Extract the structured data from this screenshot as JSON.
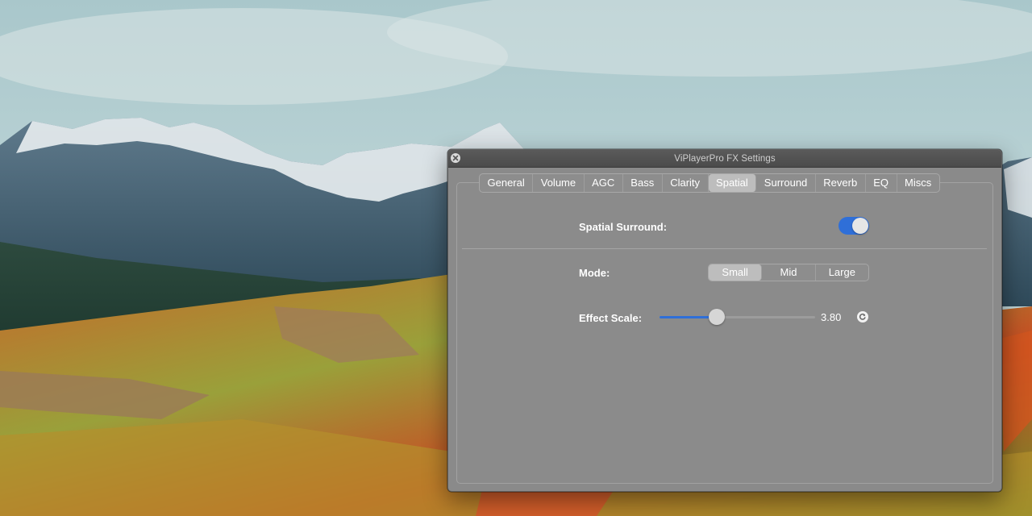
{
  "window": {
    "title": "ViPlayerPro FX Settings",
    "close_icon": "close-icon"
  },
  "tabs": [
    {
      "label": "General",
      "active": false
    },
    {
      "label": "Volume",
      "active": false
    },
    {
      "label": "AGC",
      "active": false
    },
    {
      "label": "Bass",
      "active": false
    },
    {
      "label": "Clarity",
      "active": false
    },
    {
      "label": "Spatial",
      "active": true
    },
    {
      "label": "Surround",
      "active": false
    },
    {
      "label": "Reverb",
      "active": false
    },
    {
      "label": "EQ",
      "active": false
    },
    {
      "label": "Miscs",
      "active": false
    }
  ],
  "spatial": {
    "surround_label": "Spatial Surround:",
    "surround_enabled": true,
    "mode_label": "Mode:",
    "mode_options": [
      "Small",
      "Mid",
      "Large"
    ],
    "mode_selected": "Small",
    "effect_scale_label": "Effect Scale:",
    "effect_scale_value": "3.80",
    "effect_scale_fraction": 0.37,
    "reset_icon": "reset-icon"
  },
  "colors": {
    "accent": "#2f6fd8",
    "panel_bg": "#8b8b8b",
    "titlebar_bg": "#4b4b4b"
  }
}
